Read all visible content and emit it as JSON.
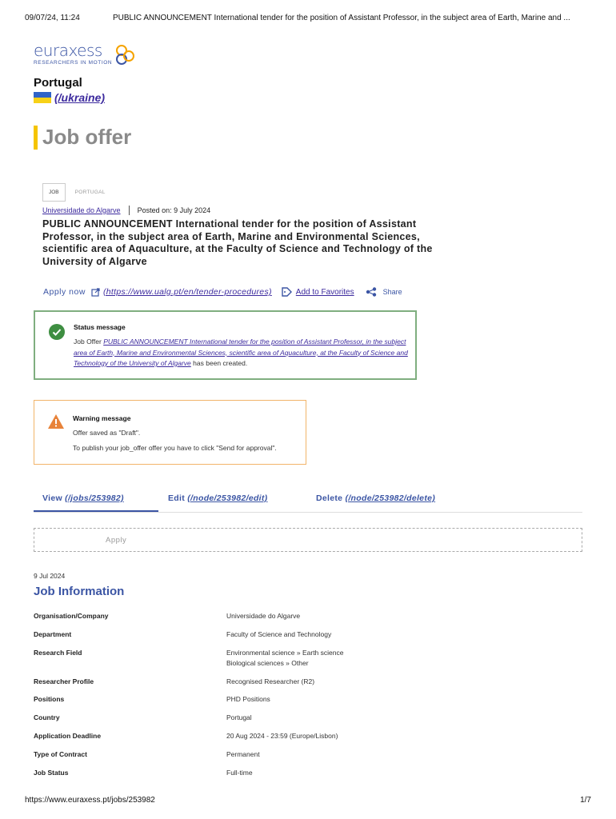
{
  "print_header": {
    "timestamp": "09/07/24, 11:24",
    "title": "PUBLIC ANNOUNCEMENT International tender for the position of Assistant Professor, in the subject area of Earth, Marine and ..."
  },
  "logo": {
    "brand": "euraxess",
    "tagline": "RESEARCHERS IN MOTION"
  },
  "country": "Portugal",
  "ukraine_link": "(/ukraine)",
  "page_heading": "Job offer",
  "tags": {
    "type": "JOB",
    "country": "PORTUGAL"
  },
  "meta": {
    "organisation": "Universidade do Algarve",
    "posted": "Posted on: 9 July 2024"
  },
  "job_title": "PUBLIC ANNOUNCEMENT International tender for the position of Assistant Professor, in the subject area of Earth, Marine and Environmental Sciences, scientific area of Aquaculture, at the Faculty of Science and Technology of the University of Algarve",
  "actions": {
    "apply_label": "Apply now",
    "apply_url": "(https://www.ualg.pt/en/tender-procedures)",
    "favorites": "Add to Favorites",
    "share": "Share"
  },
  "status_message": {
    "title": "Status message",
    "prefix": "Job Offer",
    "link": "PUBLIC ANNOUNCEMENT International tender for the position of Assistant Professor, in the subject area of Earth, Marine and Environmental Sciences, scientific area of Aquaculture, at the Faculty of Science and Technology of the University of Algarve",
    "suffix": "has been created."
  },
  "warning_message": {
    "title": "Warning message",
    "line1": "Offer saved as \"Draft\".",
    "line2": "To publish your job_offer offer you have to click \"Send for approval\"."
  },
  "tabs": {
    "view_label": "View",
    "view_url": "(/jobs/253982)",
    "edit_label": "Edit",
    "edit_url": "(/node/253982/edit)",
    "delete_label": "Delete",
    "delete_url": "(/node/253982/delete)"
  },
  "apply_button": "Apply",
  "date": "9 Jul 2024",
  "info_heading": "Job Information",
  "info": [
    {
      "key": "Organisation/Company",
      "value": "Universidade do Algarve"
    },
    {
      "key": "Department",
      "value": "Faculty of Science and Technology"
    },
    {
      "key": "Research Field",
      "value": "Environmental science » Earth science",
      "value2": "Biological sciences » Other"
    },
    {
      "key": "Researcher Profile",
      "value": "Recognised Researcher (R2)"
    },
    {
      "key": "Positions",
      "value": "PHD Positions"
    },
    {
      "key": "Country",
      "value": "Portugal"
    },
    {
      "key": "Application Deadline",
      "value": "20 Aug 2024 - 23:59 (Europe/Lisbon)"
    },
    {
      "key": "Type of Contract",
      "value": "Permanent"
    },
    {
      "key": "Job Status",
      "value": "Full-time"
    }
  ],
  "print_footer": {
    "url": "https://www.euraxess.pt/jobs/253982",
    "page": "1/7"
  },
  "colors": {
    "brand_blue": "#3b55a4",
    "link_purple": "#3c2a9e",
    "accent_yellow": "#f5c400",
    "success_green": "#3e8e41",
    "warning_orange": "#e8833a"
  }
}
